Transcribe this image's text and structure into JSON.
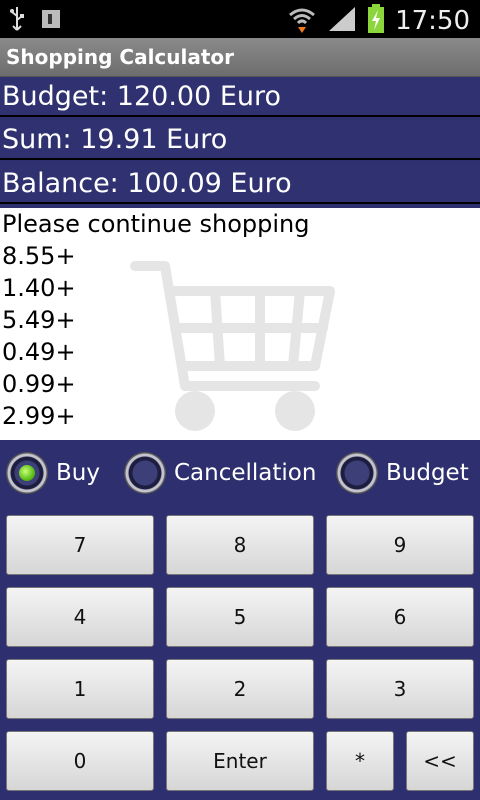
{
  "status_bar": {
    "time": "17:50",
    "icons": [
      "usb-icon",
      "sim-card-icon",
      "wifi-icon",
      "signal-icon",
      "battery-charging-icon"
    ]
  },
  "app": {
    "title": "Shopping Calculator"
  },
  "summary": {
    "budget": "Budget: 120.00 Euro",
    "sum": "Sum: 19.91 Euro",
    "balance": "Balance: 100.09 Euro"
  },
  "list": {
    "message": "Please continue shopping",
    "items": [
      "8.55+",
      "1.40+",
      "5.49+",
      "0.49+",
      "0.99+",
      "2.99+"
    ]
  },
  "modes": {
    "buy": "Buy",
    "cancellation": "Cancellation",
    "budget": "Budget",
    "selected": "Buy"
  },
  "keypad": {
    "k7": "7",
    "k8": "8",
    "k9": "9",
    "k4": "4",
    "k5": "5",
    "k6": "6",
    "k1": "1",
    "k2": "2",
    "k3": "3",
    "k0": "0",
    "enter": "Enter",
    "star": "*",
    "back": "<<"
  },
  "colors": {
    "background": "#2e2f6e",
    "accent": "#5bbf16"
  }
}
